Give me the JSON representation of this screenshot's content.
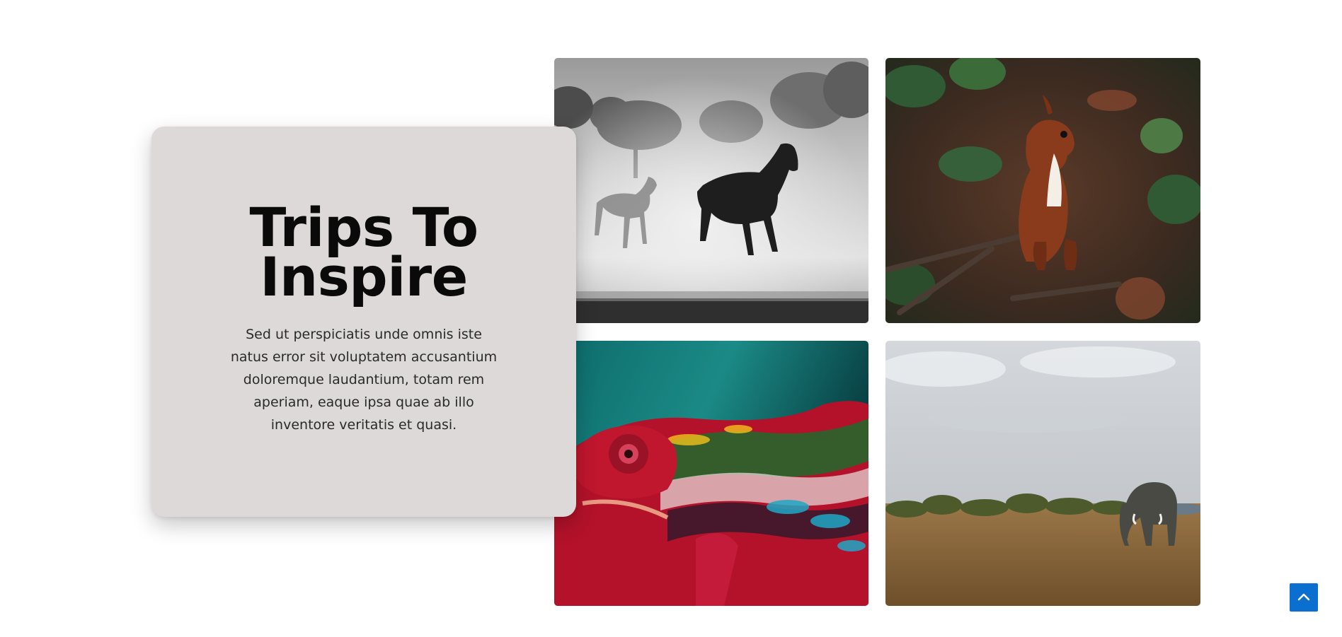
{
  "section": {
    "title": "Trips To Inspire",
    "description": "Sed ut perspiciatis unde omnis iste natus error sit voluptatem accusantium doloremque laudantium, totam rem aperiam, eaque ipsa quae ab illo inventore veritatis et quasi."
  },
  "gallery": {
    "images": [
      {
        "subject": "horses"
      },
      {
        "subject": "squirrel"
      },
      {
        "subject": "chameleon"
      },
      {
        "subject": "elephant"
      }
    ]
  },
  "controls": {
    "scroll_top_icon": "chevron-up-icon",
    "scroll_top_color": "#0b6fd0"
  },
  "colors": {
    "card_background": "#dcd9d8",
    "title": "#0a0a0a",
    "body_text": "#2a2a2a"
  }
}
